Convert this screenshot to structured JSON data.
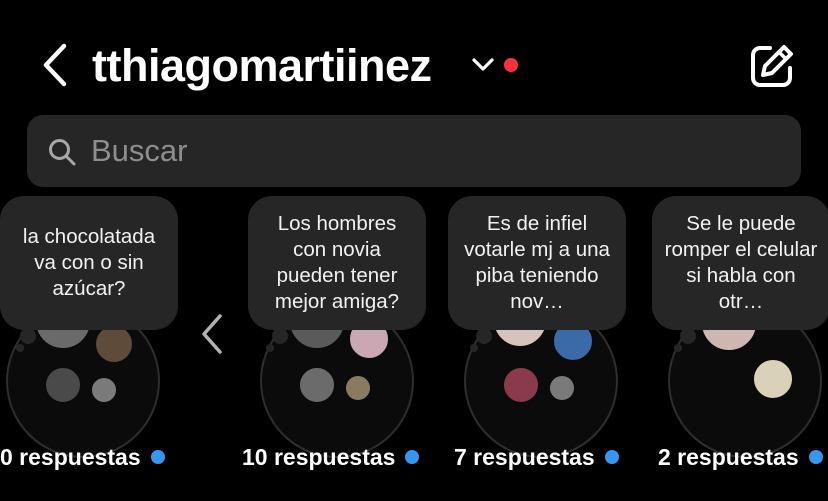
{
  "header": {
    "username": "tthiagomartiinez",
    "back_icon": "chevron-left-icon",
    "switch_icon": "chevron-down-icon",
    "notification_dot_color": "#ff3040",
    "compose_icon": "compose-icon"
  },
  "search": {
    "placeholder": "Buscar",
    "value": "",
    "icon": "search-icon"
  },
  "notes": [
    {
      "question": "la chocolatada va con o sin azúcar?",
      "responses": "0 respuestas"
    },
    {
      "question": "Los hombres con novia pueden tener mejor amiga?",
      "responses": "10 respuestas"
    },
    {
      "question": "Es de infiel votarle mj a una piba teniendo nov…",
      "responses": "7 respuestas"
    },
    {
      "question": "Se le puede romper el celular si habla con otr…",
      "responses": "2 respuestas"
    }
  ],
  "carousel": {
    "prev_icon": "chevron-left-icon"
  },
  "colors": {
    "background": "#000000",
    "surface": "#262626",
    "unread_dot": "#3797f0",
    "placeholder": "#8e8e8e"
  }
}
